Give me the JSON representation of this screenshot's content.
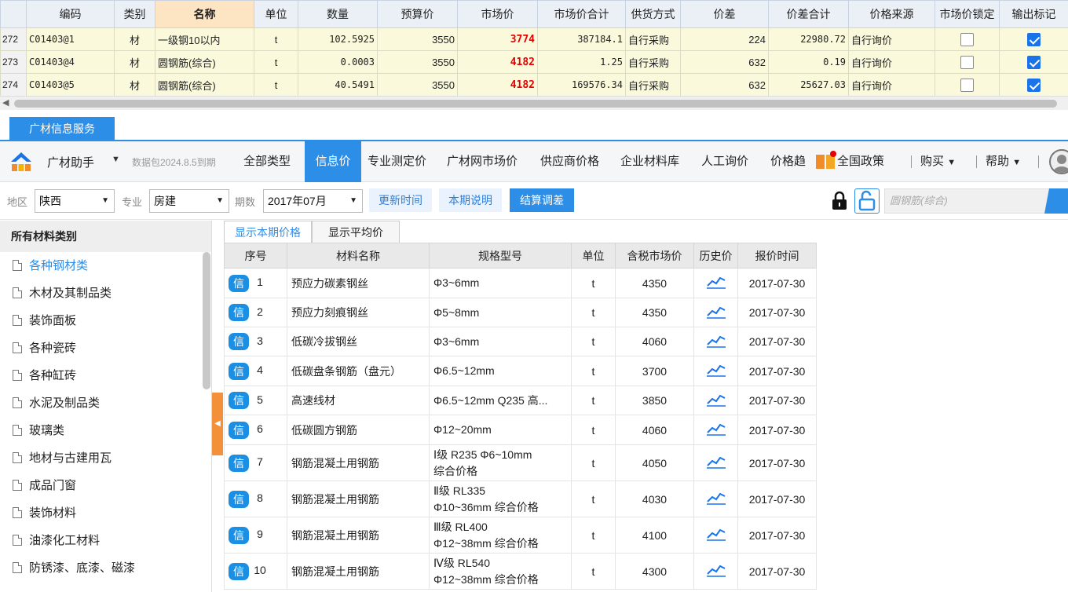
{
  "top_grid": {
    "headers": [
      "编码",
      "类别",
      "名称",
      "单位",
      "数量",
      "预算价",
      "市场价",
      "市场价合计",
      "供货方式",
      "价差",
      "价差合计",
      "价格来源",
      "市场价锁定",
      "输出标记"
    ],
    "rows": [
      {
        "row_num": "272",
        "code": "C01403@1",
        "category": "材",
        "name": "一级钢10以内",
        "unit": "t",
        "qty": "102.5925",
        "budget": "3550",
        "market": "3774",
        "market_total": "387184.1",
        "supply": "自行采购",
        "diff": "224",
        "diff_total": "22980.72",
        "source": "自行询价",
        "locked": false,
        "output": true
      },
      {
        "row_num": "273",
        "code": "C01403@4",
        "category": "材",
        "name": "圆钢筋(综合)",
        "unit": "t",
        "qty": "0.0003",
        "budget": "3550",
        "market": "4182",
        "market_total": "1.25",
        "supply": "自行采购",
        "diff": "632",
        "diff_total": "0.19",
        "source": "自行询价",
        "locked": false,
        "output": true
      },
      {
        "row_num": "274",
        "code": "C01403@5",
        "category": "材",
        "name": "圆钢筋(综合)",
        "unit": "t",
        "qty": "40.5491",
        "budget": "3550",
        "market": "4182",
        "market_total": "169576.34",
        "supply": "自行采购",
        "diff": "632",
        "diff_total": "25627.03",
        "source": "自行询价",
        "locked": false,
        "output": true
      }
    ]
  },
  "panel": {
    "tab_label": "广材信息服务"
  },
  "toolbar": {
    "brand": "广材助手",
    "expire_note": "数据包2024.8.5到期",
    "nav": [
      "全部类型",
      "信息价",
      "专业测定价",
      "广材网市场价",
      "供应商价格",
      "企业材料库",
      "人工询价",
      "价格趋",
      "全国政策"
    ],
    "active_nav": "信息价",
    "buy": "购买",
    "help": "帮助"
  },
  "filters": {
    "region_label": "地区",
    "region_value": "陕西",
    "specialty_label": "专业",
    "specialty_value": "房建",
    "period_label": "期数",
    "period_value": "2017年07月",
    "update_time": "更新时间",
    "period_note": "本期说明",
    "settle_adjust": "结算调差",
    "search_placeholder": "圆钢筋(综合)"
  },
  "sidebar": {
    "title": "所有材料类别",
    "items": [
      "各种钢材类",
      "木材及其制品类",
      "装饰面板",
      "各种瓷砖",
      "各种缸砖",
      "水泥及制品类",
      "玻璃类",
      "地材与古建用瓦",
      "成品门窗",
      "装饰材料",
      "油漆化工材料",
      "防锈漆、底漆、磁漆"
    ],
    "active_item": "各种钢材类"
  },
  "subtabs": [
    "显示本期价格",
    "显示平均价"
  ],
  "price_table": {
    "badge": "信",
    "headers": [
      "序号",
      "材料名称",
      "规格型号",
      "单位",
      "含税市场价",
      "历史价",
      "报价时间"
    ],
    "rows": [
      {
        "no": "1",
        "name": "预应力碳素钢丝",
        "spec1": "Φ3~6mm",
        "spec2": "",
        "unit": "t",
        "price": "4350",
        "date": "2017-07-30"
      },
      {
        "no": "2",
        "name": "预应力刻痕钢丝",
        "spec1": "Φ5~8mm",
        "spec2": "",
        "unit": "t",
        "price": "4350",
        "date": "2017-07-30"
      },
      {
        "no": "3",
        "name": "低碳冷拔钢丝",
        "spec1": "Φ3~6mm",
        "spec2": "",
        "unit": "t",
        "price": "4060",
        "date": "2017-07-30"
      },
      {
        "no": "4",
        "name": "低碳盘条钢筋（盘元）",
        "spec1": "Φ6.5~12mm",
        "spec2": "",
        "unit": "t",
        "price": "3700",
        "date": "2017-07-30"
      },
      {
        "no": "5",
        "name": "高速线材",
        "spec1": "Φ6.5~12mm Q235 高...",
        "spec2": "",
        "unit": "t",
        "price": "3850",
        "date": "2017-07-30"
      },
      {
        "no": "6",
        "name": "低碳圆方钢筋",
        "spec1": "Φ12~20mm",
        "spec2": "",
        "unit": "t",
        "price": "4060",
        "date": "2017-07-30"
      },
      {
        "no": "7",
        "name": "钢筋混凝土用钢筋",
        "spec1": "Ⅰ级 R235  Φ6~10mm",
        "spec2": "综合价格",
        "unit": "t",
        "price": "4050",
        "date": "2017-07-30"
      },
      {
        "no": "8",
        "name": "钢筋混凝土用钢筋",
        "spec1": "Ⅱ级 RL335",
        "spec2": "Φ10~36mm  综合价格",
        "unit": "t",
        "price": "4030",
        "date": "2017-07-30"
      },
      {
        "no": "9",
        "name": "钢筋混凝土用钢筋",
        "spec1": "Ⅲ级 RL400",
        "spec2": "Φ12~38mm  综合价格",
        "unit": "t",
        "price": "4100",
        "date": "2017-07-30"
      },
      {
        "no": "10",
        "name": "钢筋混凝土用钢筋",
        "spec1": "Ⅳ级 RL540",
        "spec2": "Φ12~38mm  综合价格",
        "unit": "t",
        "price": "4300",
        "date": "2017-07-30"
      }
    ]
  },
  "colors": {
    "accent": "#2d8ee8",
    "price_red": "#e60000",
    "grid_yellow": "#fbf9dc",
    "collapse_orange": "#f2913a"
  },
  "icons": [
    "logo-icon",
    "dropdown-arrow-icon",
    "policy-book-icon",
    "avatar-icon",
    "lock-icon",
    "unlock-icon",
    "search-icon",
    "doc-icon",
    "history-chart-icon",
    "checkbox-icon"
  ]
}
